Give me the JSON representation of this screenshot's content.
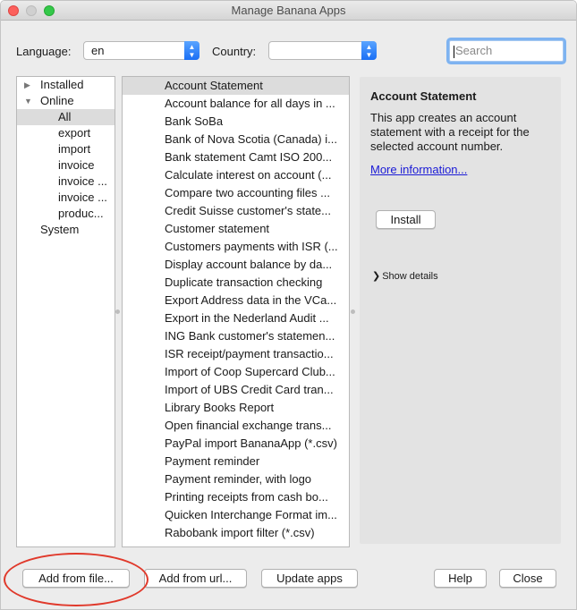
{
  "window": {
    "title": "Manage Banana Apps"
  },
  "filters": {
    "language_label": "Language:",
    "language_value": "en",
    "country_label": "Country:",
    "country_value": "",
    "search_placeholder": "Search"
  },
  "tree": {
    "installed": "Installed",
    "online": "Online",
    "children": [
      "All",
      "export",
      "import",
      "invoice",
      "invoice ...",
      "invoice ...",
      "produc..."
    ],
    "system": "System"
  },
  "apps": [
    "Account Statement",
    "Account balance for all days in ...",
    "Bank SoBa",
    "Bank of Nova Scotia (Canada) i...",
    "Bank statement Camt ISO 200...",
    "Calculate interest on account (...",
    "Compare two accounting files ...",
    "Credit Suisse customer's state...",
    "Customer statement",
    "Customers payments with ISR (...",
    "Display account balance by da...",
    "Duplicate transaction checking",
    "Export Address data in the VCa...",
    "Export in the Nederland Audit ...",
    "ING Bank customer's statemen...",
    "ISR receipt/payment transactio...",
    "Import of Coop Supercard Club...",
    "Import of UBS Credit Card tran...",
    "Library Books Report",
    "Open financial exchange trans...",
    "PayPal import BananaApp (*.csv)",
    "Payment reminder",
    "Payment reminder, with logo",
    "Printing receipts from cash bo...",
    "Quicken Interchange Format im...",
    "Rabobank import filter (*.csv)"
  ],
  "detail": {
    "title": "Account Statement",
    "description": "This app creates an account statement with a receipt for the selected account number.",
    "more_info": "More information...",
    "install": "Install",
    "show_details": "Show details"
  },
  "buttons": {
    "add_from_file": "Add from file...",
    "add_from_url": "Add from url...",
    "update_apps": "Update apps",
    "help": "Help",
    "close": "Close"
  },
  "colors": {
    "accent": "#1a6ff5",
    "link": "#1a1ad6",
    "selection": "#dcdcdc",
    "annotation": "#e0392b"
  }
}
